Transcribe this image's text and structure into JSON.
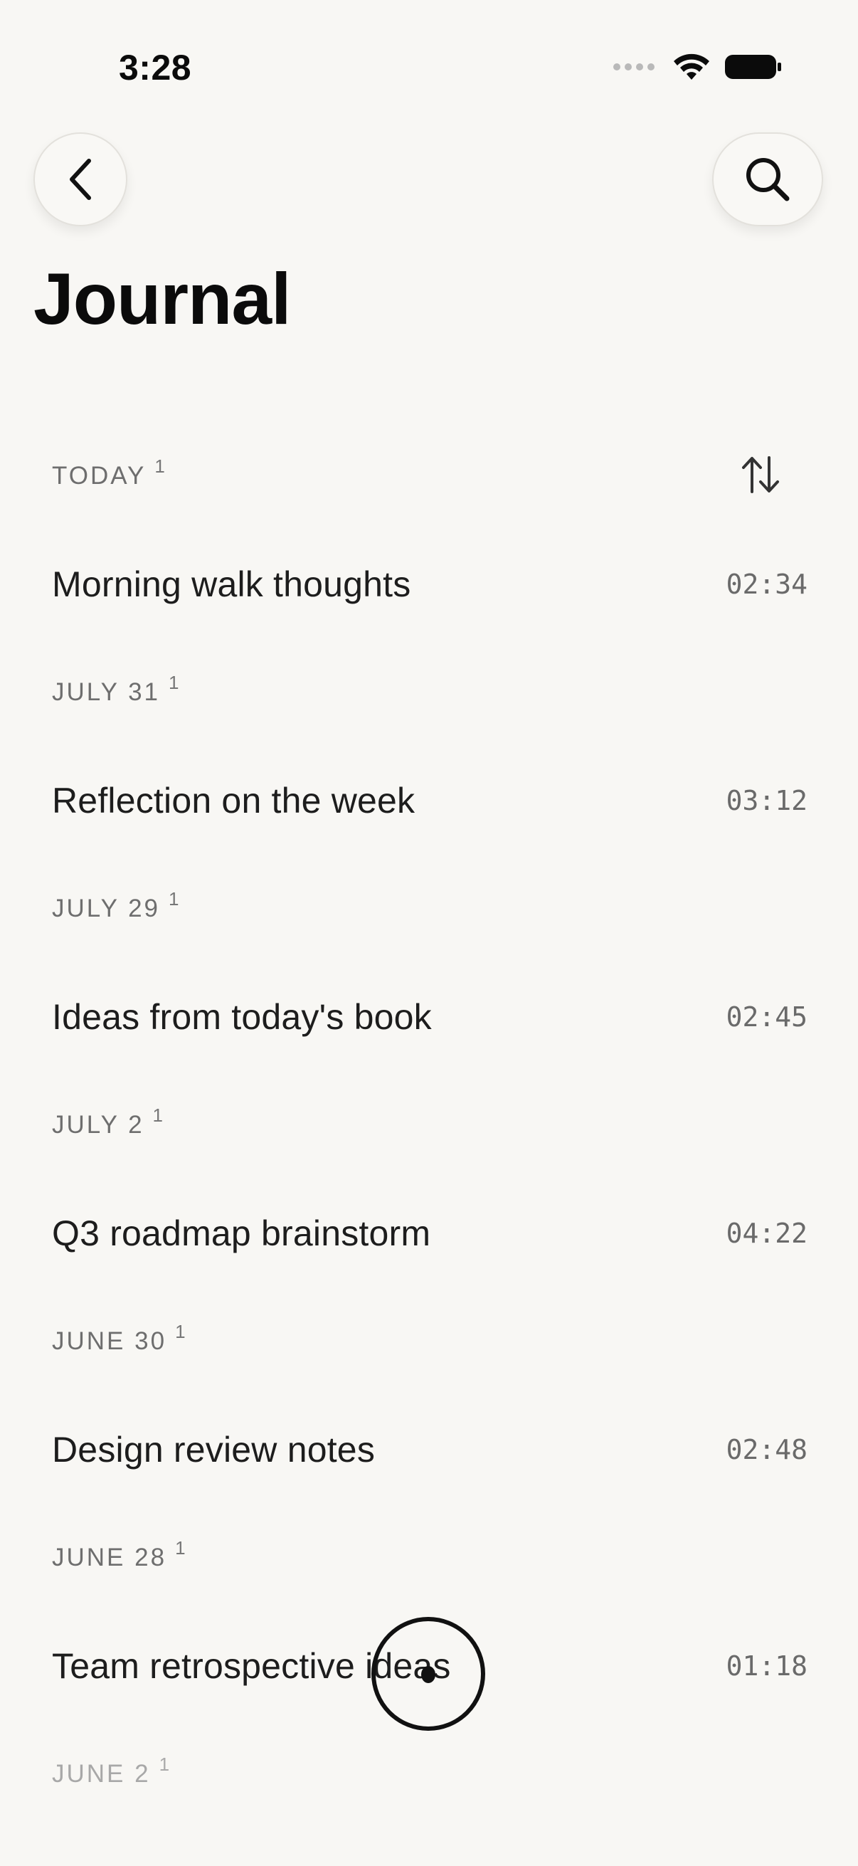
{
  "status_bar": {
    "time": "3:28"
  },
  "header": {
    "title": "Journal",
    "back_icon": "chevron-left-icon",
    "search_icon": "magnifier-icon",
    "sort_icon": "arrows-up-down-icon"
  },
  "sections": [
    {
      "label": "TODAY",
      "count": "1",
      "entry": {
        "title": "Morning walk thoughts",
        "duration": "02:34"
      }
    },
    {
      "label": "JULY 31",
      "count": "1",
      "entry": {
        "title": "Reflection on the week",
        "duration": "03:12"
      }
    },
    {
      "label": "JULY 29",
      "count": "1",
      "entry": {
        "title": "Ideas from today's book",
        "duration": "02:45"
      }
    },
    {
      "label": "JULY 2",
      "count": "1",
      "entry": {
        "title": "Q3 roadmap brainstorm",
        "duration": "04:22"
      }
    },
    {
      "label": "JUNE 30",
      "count": "1",
      "entry": {
        "title": "Design review notes",
        "duration": "02:48"
      }
    },
    {
      "label": "JUNE 28",
      "count": "1",
      "entry": {
        "title": "Team retrospective ideas",
        "duration": "01:18"
      }
    },
    {
      "label": "JUNE 2",
      "count": "1"
    }
  ],
  "colors": {
    "background": "#f8f7f4",
    "text_primary": "#1d1d1d",
    "text_secondary": "#6e6e6e"
  }
}
